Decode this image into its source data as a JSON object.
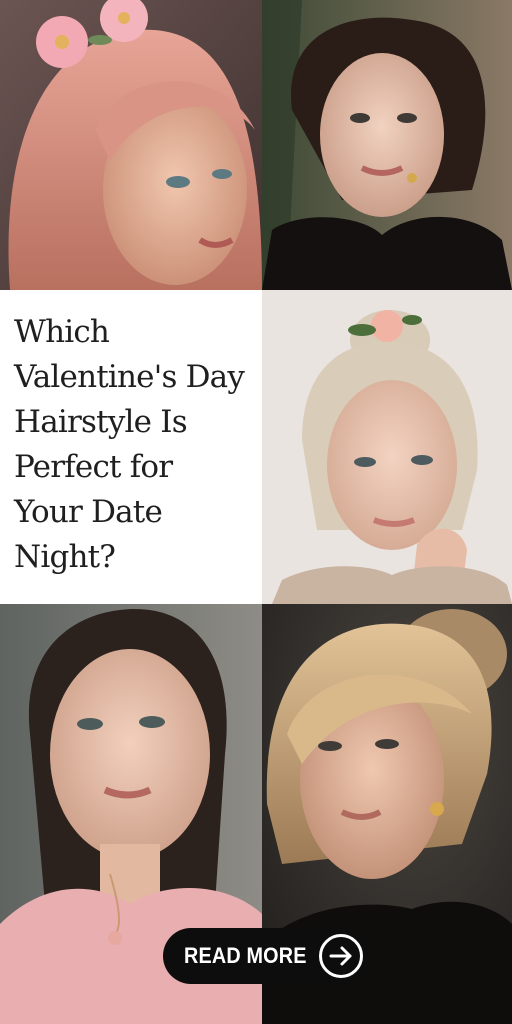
{
  "title_lines": [
    "Which",
    "Valentine's Day",
    "Hairstyle Is",
    "Perfect for",
    "Your Date",
    "Night?"
  ],
  "cta": {
    "label": "READ MORE",
    "icon": "arrow-right-circle-icon"
  },
  "photos": [
    {
      "name": "photo-pink-hair-flower",
      "icon": "portrait-photo"
    },
    {
      "name": "photo-brunette-updo-lace",
      "icon": "portrait-photo"
    },
    {
      "name": "photo-blonde-bun-flower",
      "icon": "portrait-photo"
    },
    {
      "name": "photo-brunette-pink-top",
      "icon": "portrait-photo"
    },
    {
      "name": "photo-blonde-bangs-black",
      "icon": "portrait-photo"
    }
  ],
  "colors": {
    "text": "#1f1f1f",
    "button_bg": "#0d0d0d",
    "button_text": "#ffffff"
  }
}
